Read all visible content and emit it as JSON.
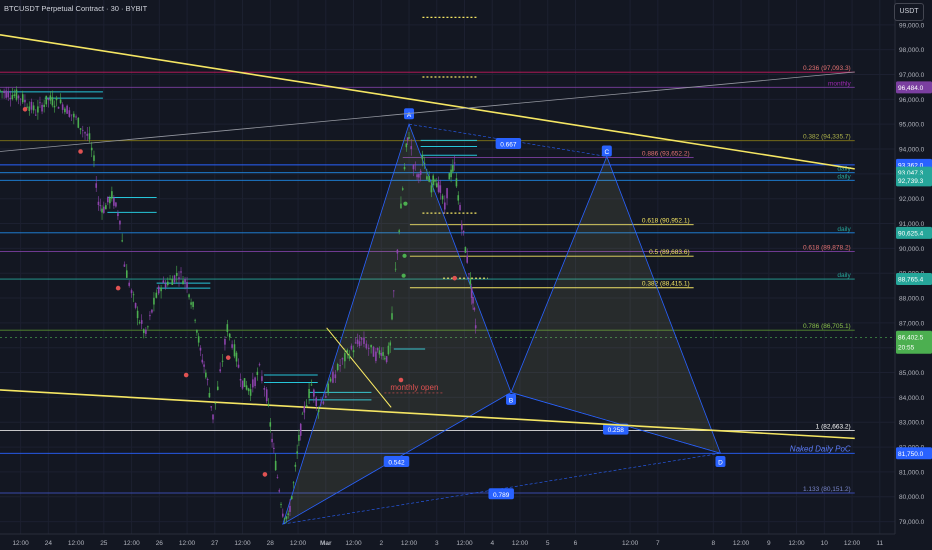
{
  "title": "BTCUSDT Perpetual Contract · 30 · BYBIT",
  "currency_button": "USDT",
  "colors": {
    "background": "#131722",
    "axis_text": "#b2b5be",
    "yellow": "#f5e663",
    "blue": "#2962ff",
    "cyan": "#26c6da",
    "purple": "#7b3fa0",
    "red": "#e05252",
    "green": "#4caf50",
    "candle": "#8e44ad"
  },
  "chart_data": {
    "type": "candlestick",
    "ylim": [
      78500,
      100000
    ],
    "xlim": [
      0,
      1
    ],
    "y_ticks": [
      79000,
      80000,
      81000,
      82000,
      83000,
      84000,
      85000,
      86000,
      87000,
      88000,
      89000,
      90000,
      91000,
      92000,
      93000,
      94000,
      95000,
      96000,
      97000,
      98000,
      99000
    ],
    "y_tick_labels": [
      "79,000.0",
      "80,000.0",
      "81,000.0",
      "82,000.0",
      "83,000.0",
      "84,000.0",
      "85,000.0",
      "86,000.0",
      "87,000.0",
      "88,000.0",
      "89,000.0",
      "90,000.0",
      "91,000.0",
      "92,000.0",
      "93,000.0",
      "94,000.0",
      "95,000.0",
      "96,000.0",
      "97,000.0",
      "98,000.0",
      "99,000.0"
    ],
    "x_ticks": [
      {
        "label": "12:00",
        "x": 0.023
      },
      {
        "label": "24",
        "x": 0.054
      },
      {
        "label": "12:00",
        "x": 0.085
      },
      {
        "label": "25",
        "x": 0.116
      },
      {
        "label": "12:00",
        "x": 0.147
      },
      {
        "label": "26",
        "x": 0.178
      },
      {
        "label": "12:00",
        "x": 0.209
      },
      {
        "label": "27",
        "x": 0.24
      },
      {
        "label": "12:00",
        "x": 0.271
      },
      {
        "label": "28",
        "x": 0.302
      },
      {
        "label": "12:00",
        "x": 0.333
      },
      {
        "label": "Mar",
        "x": 0.364
      },
      {
        "label": "12:00",
        "x": 0.395
      },
      {
        "label": "2",
        "x": 0.426
      },
      {
        "label": "12:00",
        "x": 0.457
      },
      {
        "label": "3",
        "x": 0.488
      },
      {
        "label": "12:00",
        "x": 0.519
      },
      {
        "label": "4",
        "x": 0.55
      },
      {
        "label": "12:00",
        "x": 0.581
      },
      {
        "label": "5",
        "x": 0.612
      },
      {
        "label": "6",
        "x": 0.643
      },
      {
        "label": "12:00",
        "x": 0.704
      },
      {
        "label": "7",
        "x": 0.735
      },
      {
        "label": "8",
        "x": 0.797
      },
      {
        "label": "12:00",
        "x": 0.828
      },
      {
        "label": "9",
        "x": 0.859
      },
      {
        "label": "12:00",
        "x": 0.89
      },
      {
        "label": "10",
        "x": 0.921
      },
      {
        "label": "12:00",
        "x": 0.952
      },
      {
        "label": "11",
        "x": 0.983
      }
    ],
    "price_path": [
      [
        0.0,
        96350
      ],
      [
        0.023,
        96100
      ],
      [
        0.04,
        95500
      ],
      [
        0.054,
        96000
      ],
      [
        0.07,
        95800
      ],
      [
        0.085,
        95200
      ],
      [
        0.1,
        94400
      ],
      [
        0.105,
        93500
      ],
      [
        0.11,
        91800
      ],
      [
        0.116,
        91600
      ],
      [
        0.125,
        92100
      ],
      [
        0.134,
        91200
      ],
      [
        0.139,
        89400
      ],
      [
        0.147,
        88200
      ],
      [
        0.156,
        87100
      ],
      [
        0.163,
        86500
      ],
      [
        0.172,
        87800
      ],
      [
        0.18,
        88500
      ],
      [
        0.19,
        88700
      ],
      [
        0.2,
        89000
      ],
      [
        0.209,
        88600
      ],
      [
        0.218,
        87300
      ],
      [
        0.224,
        85800
      ],
      [
        0.23,
        85000
      ],
      [
        0.234,
        84200
      ],
      [
        0.238,
        83200
      ],
      [
        0.246,
        84900
      ],
      [
        0.254,
        86800
      ],
      [
        0.262,
        85900
      ],
      [
        0.271,
        84600
      ],
      [
        0.28,
        84300
      ],
      [
        0.29,
        85100
      ],
      [
        0.298,
        84100
      ],
      [
        0.304,
        82300
      ],
      [
        0.31,
        80800
      ],
      [
        0.316,
        79400
      ],
      [
        0.322,
        79100
      ],
      [
        0.328,
        80500
      ],
      [
        0.334,
        82300
      ],
      [
        0.34,
        83500
      ],
      [
        0.348,
        84500
      ],
      [
        0.356,
        83600
      ],
      [
        0.364,
        84100
      ],
      [
        0.372,
        84800
      ],
      [
        0.38,
        85300
      ],
      [
        0.388,
        85700
      ],
      [
        0.395,
        86000
      ],
      [
        0.404,
        86300
      ],
      [
        0.412,
        86000
      ],
      [
        0.42,
        85700
      ],
      [
        0.426,
        85900
      ],
      [
        0.432,
        85600
      ],
      [
        0.436,
        86100
      ],
      [
        0.44,
        88200
      ],
      [
        0.446,
        90800
      ],
      [
        0.45,
        92400
      ],
      [
        0.454,
        94000
      ],
      [
        0.457,
        94600
      ],
      [
        0.462,
        93400
      ],
      [
        0.468,
        92800
      ],
      [
        0.472,
        93600
      ],
      [
        0.477,
        92900
      ],
      [
        0.482,
        92500
      ],
      [
        0.486,
        92900
      ],
      [
        0.492,
        92300
      ],
      [
        0.497,
        91600
      ],
      [
        0.502,
        92900
      ],
      [
        0.508,
        93300
      ],
      [
        0.512,
        92100
      ],
      [
        0.516,
        91000
      ],
      [
        0.52,
        90000
      ],
      [
        0.524,
        89100
      ],
      [
        0.527,
        88200
      ],
      [
        0.53,
        87400
      ],
      [
        0.533,
        86400
      ]
    ],
    "current_price": {
      "value": 86402.5,
      "label": "86,402.5",
      "countdown": "20:55"
    },
    "price_labels": [
      {
        "value": 96484.0,
        "label": "96,484.0",
        "color": "#7b3fa0"
      },
      {
        "value": 93362.0,
        "label": "93,362.0",
        "color": "#2962ff"
      },
      {
        "value": 93047.3,
        "label": "93,047.3",
        "color": "#26a69a"
      },
      {
        "value": 92739.3,
        "label": "92,739.3",
        "color": "#26a69a"
      },
      {
        "value": 90625.4,
        "label": "90,625.4",
        "color": "#26a69a"
      },
      {
        "value": 88765.4,
        "label": "88,765.4",
        "color": "#26a69a"
      },
      {
        "value": 81750.0,
        "label": "81,750.0",
        "color": "#2962ff"
      }
    ],
    "horizontal_levels": [
      {
        "value": 97094,
        "color": "#c2185b",
        "x0": 0.0,
        "x1": 0.955,
        "label": "0.236 (97,093.3)",
        "label_color": "#e57373"
      },
      {
        "value": 96484,
        "color": "#7b3fa0",
        "x0": 0.0,
        "x1": 0.955,
        "label": "monthly",
        "label_color": "#9c27b0"
      },
      {
        "value": 94336,
        "color": "#827717",
        "x0": 0.0,
        "x1": 0.955,
        "label": "0.382 (94,335.7)",
        "label_color": "#aeb34a"
      },
      {
        "value": 93662,
        "color": "#7b3fa0",
        "x0": 0.45,
        "x1": 0.775,
        "label": "0.886 (93,652.2)",
        "label_color": "#e57373"
      },
      {
        "value": 93362,
        "color": "#2962ff",
        "x0": 0.0,
        "x1": 0.955,
        "label": "",
        "label_color": ""
      },
      {
        "value": 93047,
        "color": "#1e88e5",
        "x0": 0.0,
        "x1": 0.955,
        "label": "daily",
        "label_color": "#26a69a"
      },
      {
        "value": 92739,
        "color": "#1e88e5",
        "x0": 0.0,
        "x1": 0.955,
        "label": "daily",
        "label_color": "#26a69a"
      },
      {
        "value": 90952,
        "color": "#f5e663",
        "x0": 0.458,
        "x1": 0.775,
        "label": "0.618 (90,952.1)",
        "label_color": "#f5e663"
      },
      {
        "value": 90625,
        "color": "#1e88e5",
        "x0": 0.0,
        "x1": 0.955,
        "label": "daily",
        "label_color": "#26a69a"
      },
      {
        "value": 89878,
        "color": "#7b3fa0",
        "x0": 0.0,
        "x1": 0.955,
        "label": "0.618 (89,878.2)",
        "label_color": "#e57373"
      },
      {
        "value": 89684,
        "color": "#f5e663",
        "x0": 0.458,
        "x1": 0.775,
        "label": "0.5 (89,683.6)",
        "label_color": "#f5e663"
      },
      {
        "value": 88765,
        "color": "#26a69a",
        "x0": 0.0,
        "x1": 0.955,
        "label": "daily",
        "label_color": "#26a69a"
      },
      {
        "value": 88415,
        "color": "#f5e663",
        "x0": 0.458,
        "x1": 0.775,
        "label": "0.382 (88,415.1)",
        "label_color": "#f5e663"
      },
      {
        "value": 86705,
        "color": "#558b2f",
        "x0": 0.0,
        "x1": 0.955,
        "label": "0.786 (86,705.1)",
        "label_color": "#8bc34a"
      },
      {
        "value": 82663,
        "color": "#e0e0e0",
        "x0": 0.0,
        "x1": 0.955,
        "label": "1 (82,663.2)",
        "label_color": "#ffffff"
      },
      {
        "value": 81750,
        "color": "#2962ff",
        "x0": 0.0,
        "x1": 0.955,
        "label": "Naked Daily PoC",
        "label_color": "#5c7cfa"
      },
      {
        "value": 80151,
        "color": "#3949ab",
        "x0": 0.0,
        "x1": 0.955,
        "label": "1.133 (80,151.2)",
        "label_color": "#7986cb"
      }
    ],
    "dotted_levels": [
      {
        "value": 99300,
        "x0": 0.472,
        "x1": 0.534
      },
      {
        "value": 96900,
        "x0": 0.472,
        "x1": 0.534
      },
      {
        "value": 91420,
        "x0": 0.472,
        "x1": 0.534
      },
      {
        "value": 88800,
        "x0": 0.495,
        "x1": 0.545
      }
    ],
    "short_levels": [
      {
        "value": 96300,
        "x0": 0.0,
        "x1": 0.115,
        "color": "#26c6da"
      },
      {
        "value": 96050,
        "x0": 0.05,
        "x1": 0.115,
        "color": "#26c6da"
      },
      {
        "value": 92050,
        "x0": 0.12,
        "x1": 0.175,
        "color": "#26c6da"
      },
      {
        "value": 91450,
        "x0": 0.12,
        "x1": 0.175,
        "color": "#26c6da"
      },
      {
        "value": 88600,
        "x0": 0.175,
        "x1": 0.235,
        "color": "#26c6da"
      },
      {
        "value": 88400,
        "x0": 0.175,
        "x1": 0.235,
        "color": "#26c6da"
      },
      {
        "value": 84900,
        "x0": 0.295,
        "x1": 0.355,
        "color": "#26c6da"
      },
      {
        "value": 84600,
        "x0": 0.295,
        "x1": 0.355,
        "color": "#26c6da"
      },
      {
        "value": 84200,
        "x0": 0.345,
        "x1": 0.415,
        "color": "#26c6da"
      },
      {
        "value": 83900,
        "x0": 0.345,
        "x1": 0.415,
        "color": "#26c6da"
      },
      {
        "value": 85950,
        "x0": 0.44,
        "x1": 0.475,
        "color": "#26c6da"
      },
      {
        "value": 94350,
        "x0": 0.47,
        "x1": 0.533,
        "color": "#26c6da"
      },
      {
        "value": 94100,
        "x0": 0.47,
        "x1": 0.533,
        "color": "#26c6da"
      },
      {
        "value": 93750,
        "x0": 0.47,
        "x1": 0.533,
        "color": "#26c6da"
      }
    ],
    "trendlines": [
      {
        "x0": 0.0,
        "y0": 98600,
        "x1": 0.955,
        "y1": 93200,
        "color": "#f5e663",
        "width": 1.6
      },
      {
        "x0": 0.0,
        "y0": 84300,
        "x1": 0.955,
        "y1": 82350,
        "color": "#f5e663",
        "width": 1.6
      },
      {
        "x0": 0.0,
        "y0": 93900,
        "x1": 0.955,
        "y1": 97100,
        "color": "#9598a1",
        "width": 0.8
      },
      {
        "x0": 0.365,
        "y0": 86800,
        "x1": 0.437,
        "y1": 83600,
        "color": "#f5e663",
        "width": 0.9
      },
      {
        "x0": 0.365,
        "y0": 86800,
        "x1": 0.437,
        "y1": 83600,
        "color": "#f5e663",
        "width": 0.0
      }
    ],
    "harmonic": {
      "points": [
        {
          "name": "X",
          "x": 0.316,
          "y": 78900
        },
        {
          "name": "A",
          "x": 0.457,
          "y": 95000
        },
        {
          "name": "B",
          "x": 0.571,
          "y": 84200
        },
        {
          "name": "C",
          "x": 0.678,
          "y": 93700
        },
        {
          "name": "D",
          "x": 0.805,
          "y": 81750
        }
      ],
      "labels": [
        {
          "text": "A",
          "x": 0.457,
          "y": 95400
        },
        {
          "text": "B",
          "x": 0.571,
          "y": 83900
        },
        {
          "text": "C",
          "x": 0.678,
          "y": 93900
        },
        {
          "text": "D",
          "x": 0.805,
          "y": 81400
        }
      ],
      "ratios": [
        {
          "text": "0.667",
          "x": 0.568,
          "y": 94200
        },
        {
          "text": "0.542",
          "x": 0.443,
          "y": 81400
        },
        {
          "text": "0.789",
          "x": 0.56,
          "y": 80100
        },
        {
          "text": "0.258",
          "x": 0.688,
          "y": 82700
        }
      ],
      "line_color": "#2962ff",
      "fill_color": "rgba(190,190,120,0.12)"
    },
    "monthly_open": {
      "label": "monthly open",
      "value": 84300,
      "x": 0.463
    },
    "red_markers": [
      {
        "x": 0.028,
        "y": 95600
      },
      {
        "x": 0.09,
        "y": 93900
      },
      {
        "x": 0.132,
        "y": 88400
      },
      {
        "x": 0.208,
        "y": 84900
      },
      {
        "x": 0.255,
        "y": 85600
      },
      {
        "x": 0.296,
        "y": 80900
      },
      {
        "x": 0.448,
        "y": 84700
      },
      {
        "x": 0.508,
        "y": 88800
      }
    ],
    "green_markers": [
      {
        "x": 0.453,
        "y": 91800
      },
      {
        "x": 0.452,
        "y": 89700
      },
      {
        "x": 0.451,
        "y": 88900
      }
    ]
  }
}
